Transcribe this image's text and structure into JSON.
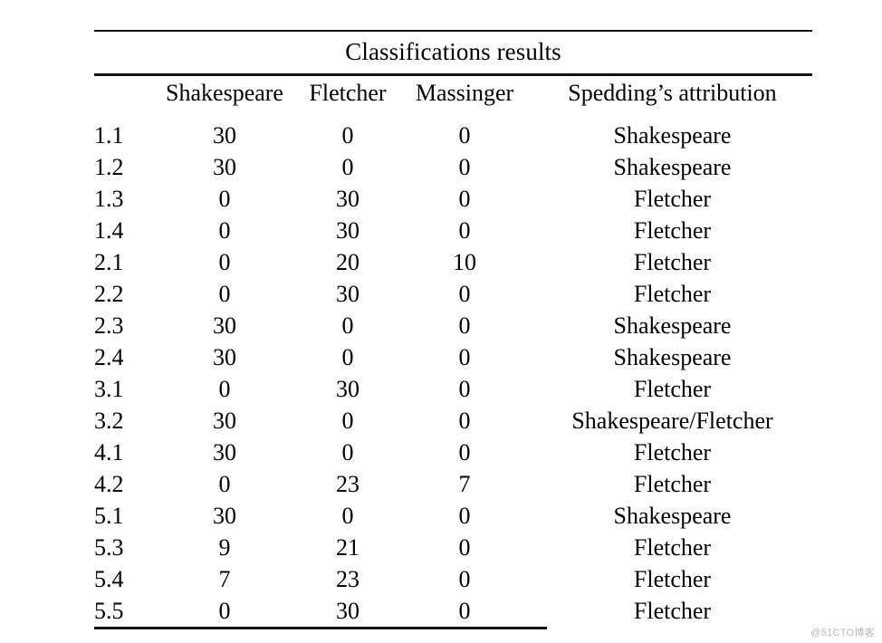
{
  "table": {
    "title": "Classifications results",
    "columns": [
      {
        "key": "id",
        "label": ""
      },
      {
        "key": "shakespeare",
        "label": "Shakespeare"
      },
      {
        "key": "fletcher",
        "label": "Fletcher"
      },
      {
        "key": "massinger",
        "label": "Massinger"
      },
      {
        "key": "attribution",
        "label": "Spedding’s attribution"
      }
    ],
    "rows": [
      {
        "id": "1.1",
        "shakespeare": "30",
        "fletcher": "0",
        "massinger": "0",
        "attribution": "Shakespeare",
        "bold": [
          "shakespeare"
        ]
      },
      {
        "id": "1.2",
        "shakespeare": "30",
        "fletcher": "0",
        "massinger": "0",
        "attribution": "Shakespeare",
        "bold": [
          "shakespeare"
        ]
      },
      {
        "id": "1.3",
        "shakespeare": "0",
        "fletcher": "30",
        "massinger": "0",
        "attribution": "Fletcher",
        "bold": [
          "fletcher"
        ]
      },
      {
        "id": "1.4",
        "shakespeare": "0",
        "fletcher": "30",
        "massinger": "0",
        "attribution": "Fletcher",
        "bold": [
          "fletcher"
        ]
      },
      {
        "id": "2.1",
        "shakespeare": "0",
        "fletcher": "20",
        "massinger": "10",
        "attribution": "Fletcher",
        "bold": [
          "fletcher"
        ]
      },
      {
        "id": "2.2",
        "shakespeare": "0",
        "fletcher": "30",
        "massinger": "0",
        "attribution": "Fletcher",
        "bold": [
          "fletcher"
        ]
      },
      {
        "id": "2.3",
        "shakespeare": "30",
        "fletcher": "0",
        "massinger": "0",
        "attribution": "Shakespeare",
        "bold": [
          "shakespeare"
        ]
      },
      {
        "id": "2.4",
        "shakespeare": "30",
        "fletcher": "0",
        "massinger": "0",
        "attribution": "Shakespeare",
        "bold": [
          "shakespeare"
        ]
      },
      {
        "id": "3.1",
        "shakespeare": "0",
        "fletcher": "30",
        "massinger": "0",
        "attribution": "Fletcher",
        "bold": [
          "fletcher"
        ]
      },
      {
        "id": "3.2",
        "shakespeare": "30",
        "fletcher": "0",
        "massinger": "0",
        "attribution": "Shakespeare/Fletcher",
        "bold": [
          "shakespeare",
          "attribution"
        ]
      },
      {
        "id": "4.1",
        "shakespeare": "30",
        "fletcher": "0",
        "massinger": "0",
        "attribution": "Fletcher",
        "bold": [
          "shakespeare",
          "attribution"
        ]
      },
      {
        "id": "4.2",
        "shakespeare": "0",
        "fletcher": "23",
        "massinger": "7",
        "attribution": "Fletcher",
        "bold": [
          "fletcher"
        ]
      },
      {
        "id": "5.1",
        "shakespeare": "30",
        "fletcher": "0",
        "massinger": "0",
        "attribution": "Shakespeare",
        "bold": [
          "shakespeare"
        ]
      },
      {
        "id": "5.3",
        "shakespeare": "9",
        "fletcher": "21",
        "massinger": "0",
        "attribution": "Fletcher",
        "bold": [
          "fletcher"
        ]
      },
      {
        "id": "5.4",
        "shakespeare": "7",
        "fletcher": "23",
        "massinger": "0",
        "attribution": "Fletcher",
        "bold": [
          "fletcher"
        ]
      },
      {
        "id": "5.5",
        "shakespeare": "0",
        "fletcher": "30",
        "massinger": "0",
        "attribution": "Fletcher",
        "bold": [
          "fletcher"
        ]
      }
    ]
  },
  "watermark": {
    "text": "@51CTO博客",
    "color": "#b9b9b9"
  }
}
